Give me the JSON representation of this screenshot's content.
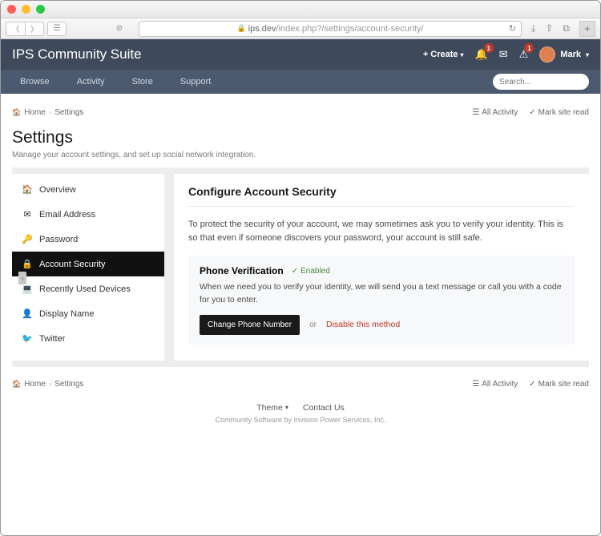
{
  "browser": {
    "url_host": "ips.dev",
    "url_path": "/index.php?/settings/account-security/"
  },
  "header": {
    "title": "IPS Community Suite",
    "create_label": "Create",
    "notif_badge": "1",
    "warn_badge": "1",
    "username": "Mark"
  },
  "nav": {
    "items": [
      "Browse",
      "Activity",
      "Store",
      "Support"
    ],
    "search_placeholder": "Search..."
  },
  "breadcrumb": {
    "home": "Home",
    "section": "Settings"
  },
  "meta": {
    "all_activity": "All Activity",
    "mark_read": "Mark site read"
  },
  "page": {
    "title": "Settings",
    "subtitle": "Manage your account settings, and set up social network integration."
  },
  "sidebar": {
    "items": [
      {
        "icon": "🏠",
        "label": "Overview"
      },
      {
        "icon": "✉",
        "label": "Email Address"
      },
      {
        "icon": "🔑",
        "label": "Password"
      },
      {
        "icon": "🔒",
        "label": "Account Security",
        "active": true
      },
      {
        "icon": "💻",
        "label": "Recently Used Devices"
      },
      {
        "icon": "👤",
        "label": "Display Name"
      },
      {
        "icon": "🐦",
        "label": "Twitter"
      }
    ]
  },
  "main": {
    "heading": "Configure Account Security",
    "intro": "To protect the security of your account, we may sometimes ask you to verify your identity. This is so that even if someone discovers your password, your account is still safe.",
    "method": {
      "title": "Phone Verification",
      "status": "Enabled",
      "desc": "When we need you to verify your identity, we will send you a text message or call you with a code for you to enter.",
      "change_btn": "Change Phone Number",
      "or": "or",
      "disable": "Disable this method"
    }
  },
  "footer": {
    "theme": "Theme",
    "contact": "Contact Us",
    "copy": "Community Software by Invision Power Services, Inc."
  }
}
